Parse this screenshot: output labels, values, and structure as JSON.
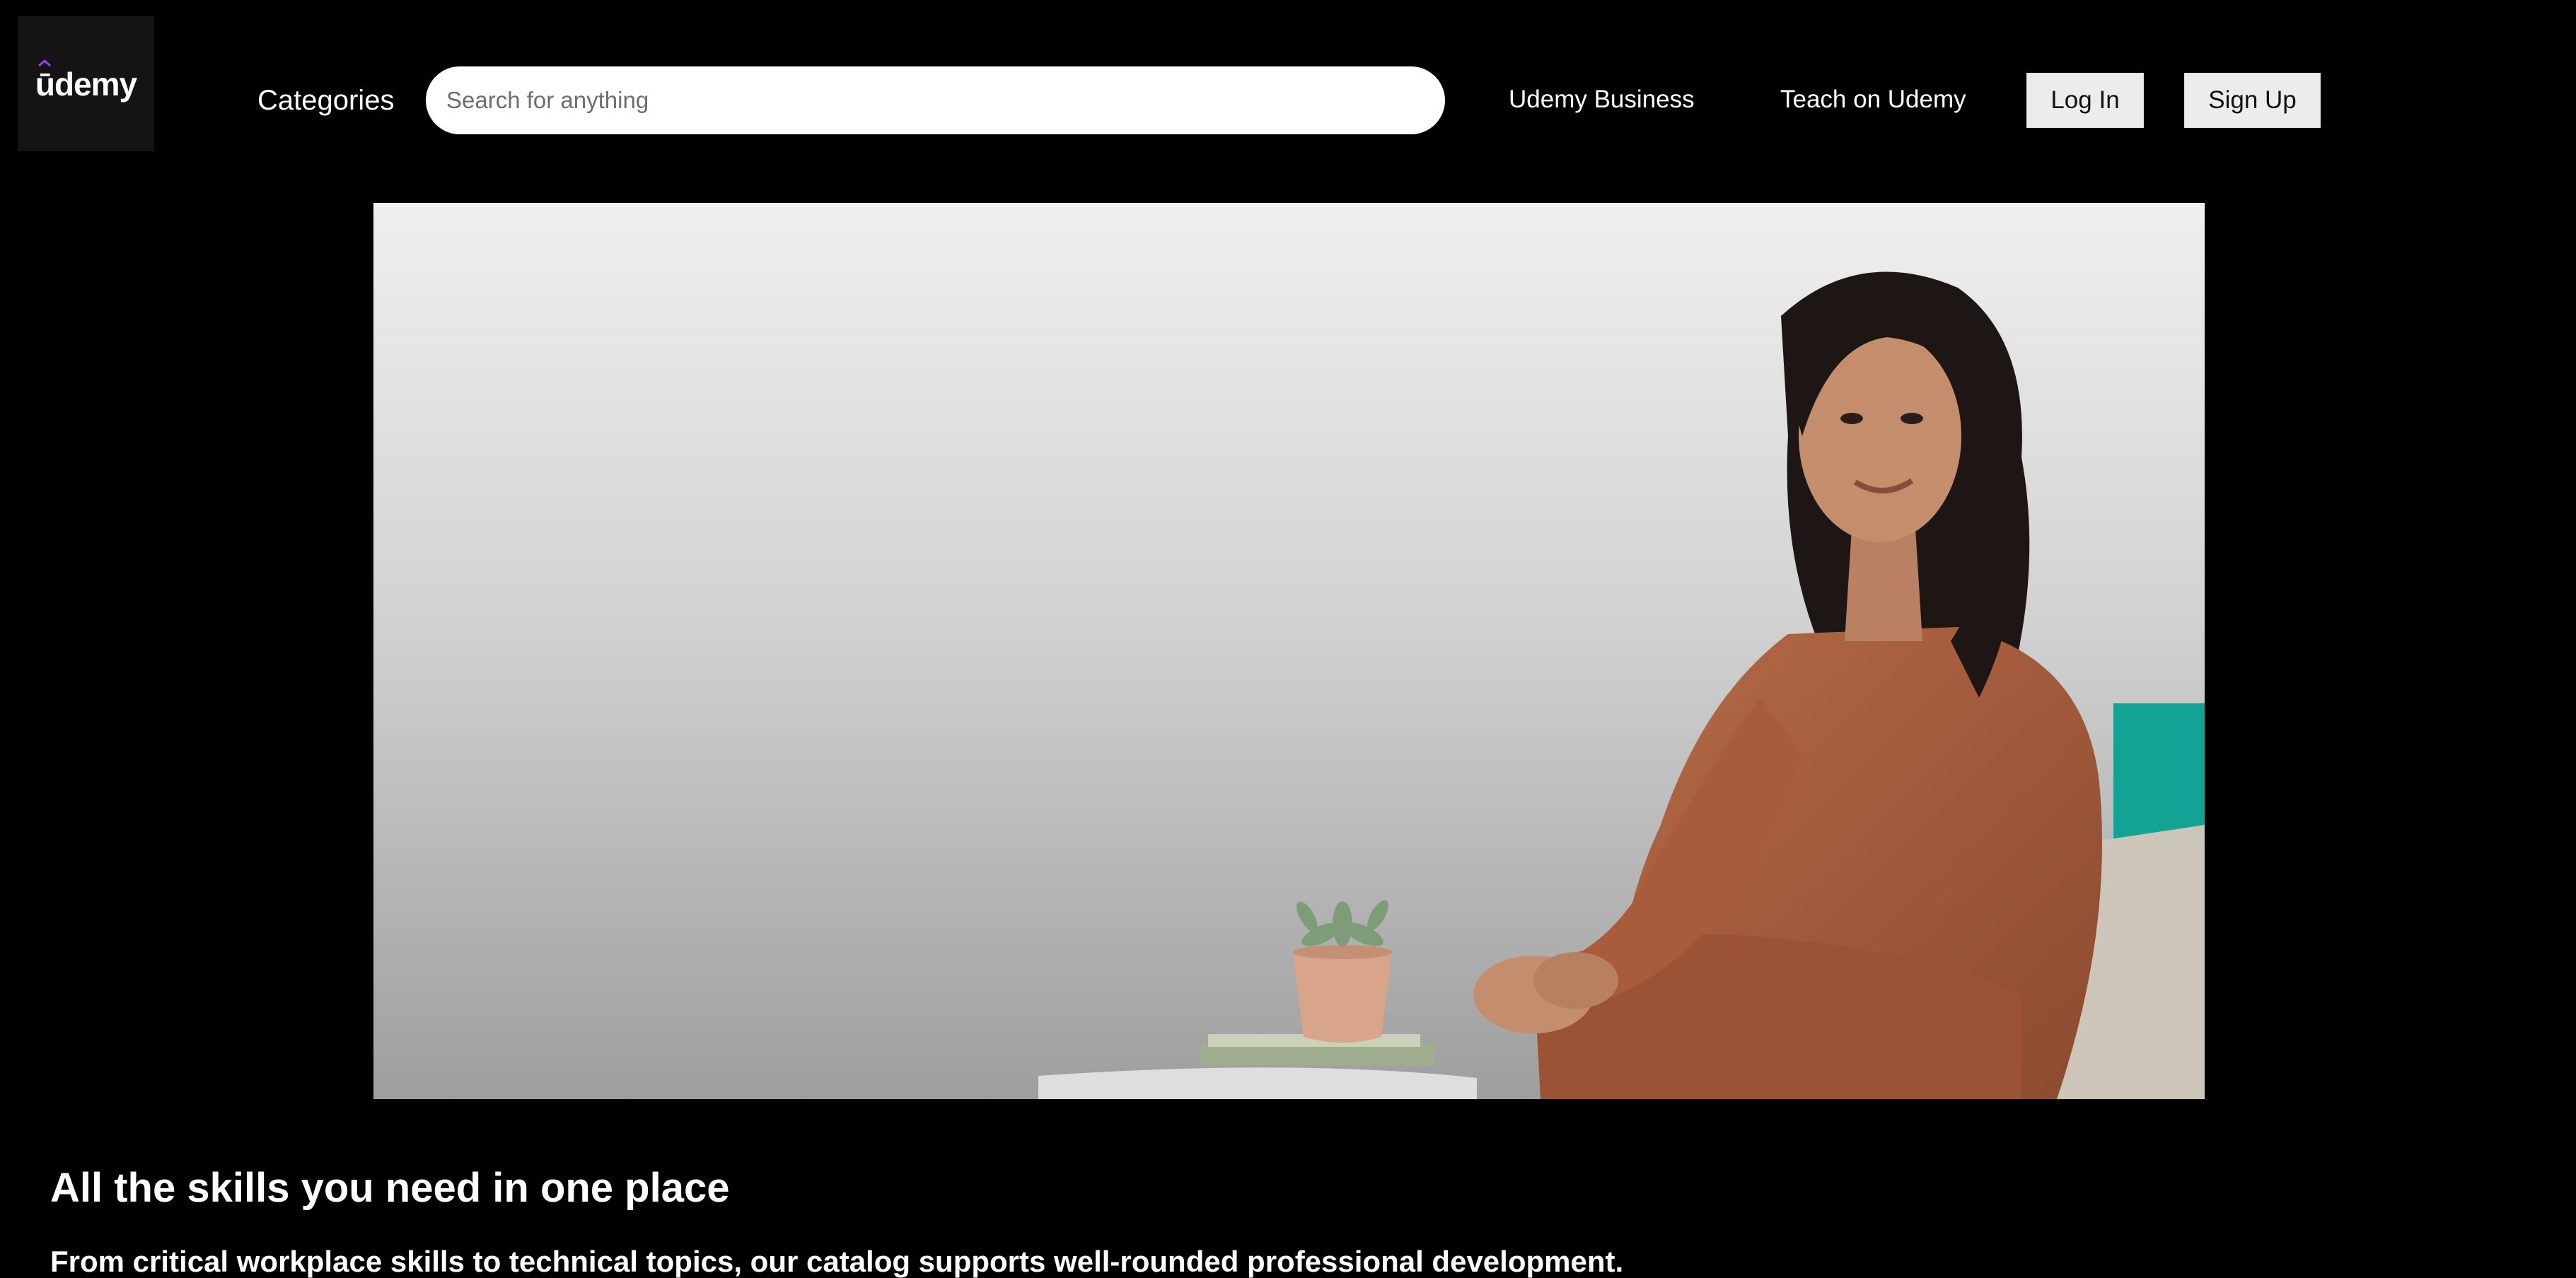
{
  "header": {
    "logo_text": "ūdemy",
    "categories_label": "Categories",
    "search": {
      "placeholder": "Search for anything",
      "value": ""
    },
    "business_label": "Udemy Business",
    "teach_label": "Teach on Udemy",
    "login_label": "Log In",
    "signup_label": "Sign Up"
  },
  "hero": {
    "image": "woman-seated-with-plant-photo"
  },
  "main": {
    "headline": "All the skills you need in one place",
    "subheadline": "From critical workplace skills to technical topics, our catalog supports well-rounded professional development."
  },
  "colors": {
    "background": "#000000",
    "logo_accent": "#a435f0",
    "button_bg": "#ececec"
  }
}
